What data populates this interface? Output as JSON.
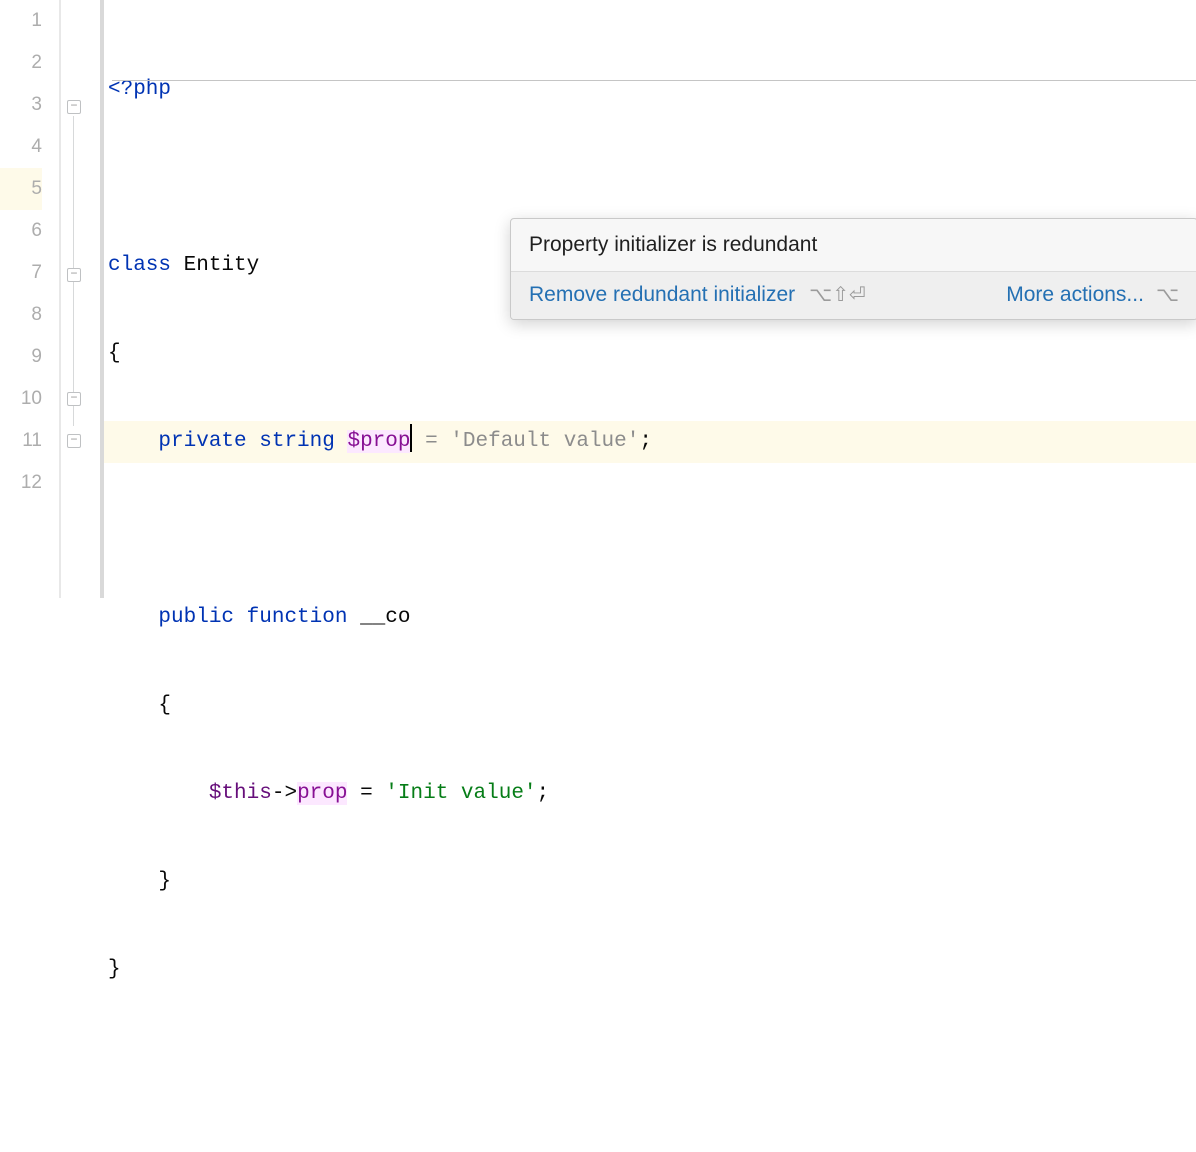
{
  "lines": [
    {
      "n": "1"
    },
    {
      "n": "2"
    },
    {
      "n": "3"
    },
    {
      "n": "4"
    },
    {
      "n": "5"
    },
    {
      "n": "6"
    },
    {
      "n": "7"
    },
    {
      "n": "8"
    },
    {
      "n": "9"
    },
    {
      "n": "10"
    },
    {
      "n": "11"
    },
    {
      "n": "12"
    }
  ],
  "code": {
    "l1": {
      "open": "<?php"
    },
    "l3": {
      "kw": "class ",
      "name": "Entity"
    },
    "l4": {
      "brace": "{"
    },
    "l5": {
      "priv": "private ",
      "type": "string ",
      "var": "$prop",
      "assign": " = ",
      "str": "'Default value'",
      "semi": ";"
    },
    "l7": {
      "pub": "public ",
      "fn": "function ",
      "name": "__co"
    },
    "l8": {
      "brace": "{"
    },
    "l9": {
      "this": "$this",
      "arrow": "->",
      "prop": "prop",
      "assign": " = ",
      "str": "'Init value'",
      "semi": ";"
    },
    "l10": {
      "brace": "}"
    },
    "l11": {
      "brace": "}"
    }
  },
  "popup": {
    "title": "Property initializer is redundant",
    "fix": "Remove redundant initializer",
    "shortcut1": "⌥⇧⏎",
    "more": "More actions...",
    "shortcut2": "⌥"
  },
  "icons": {
    "bulb": "lightbulb-icon"
  }
}
